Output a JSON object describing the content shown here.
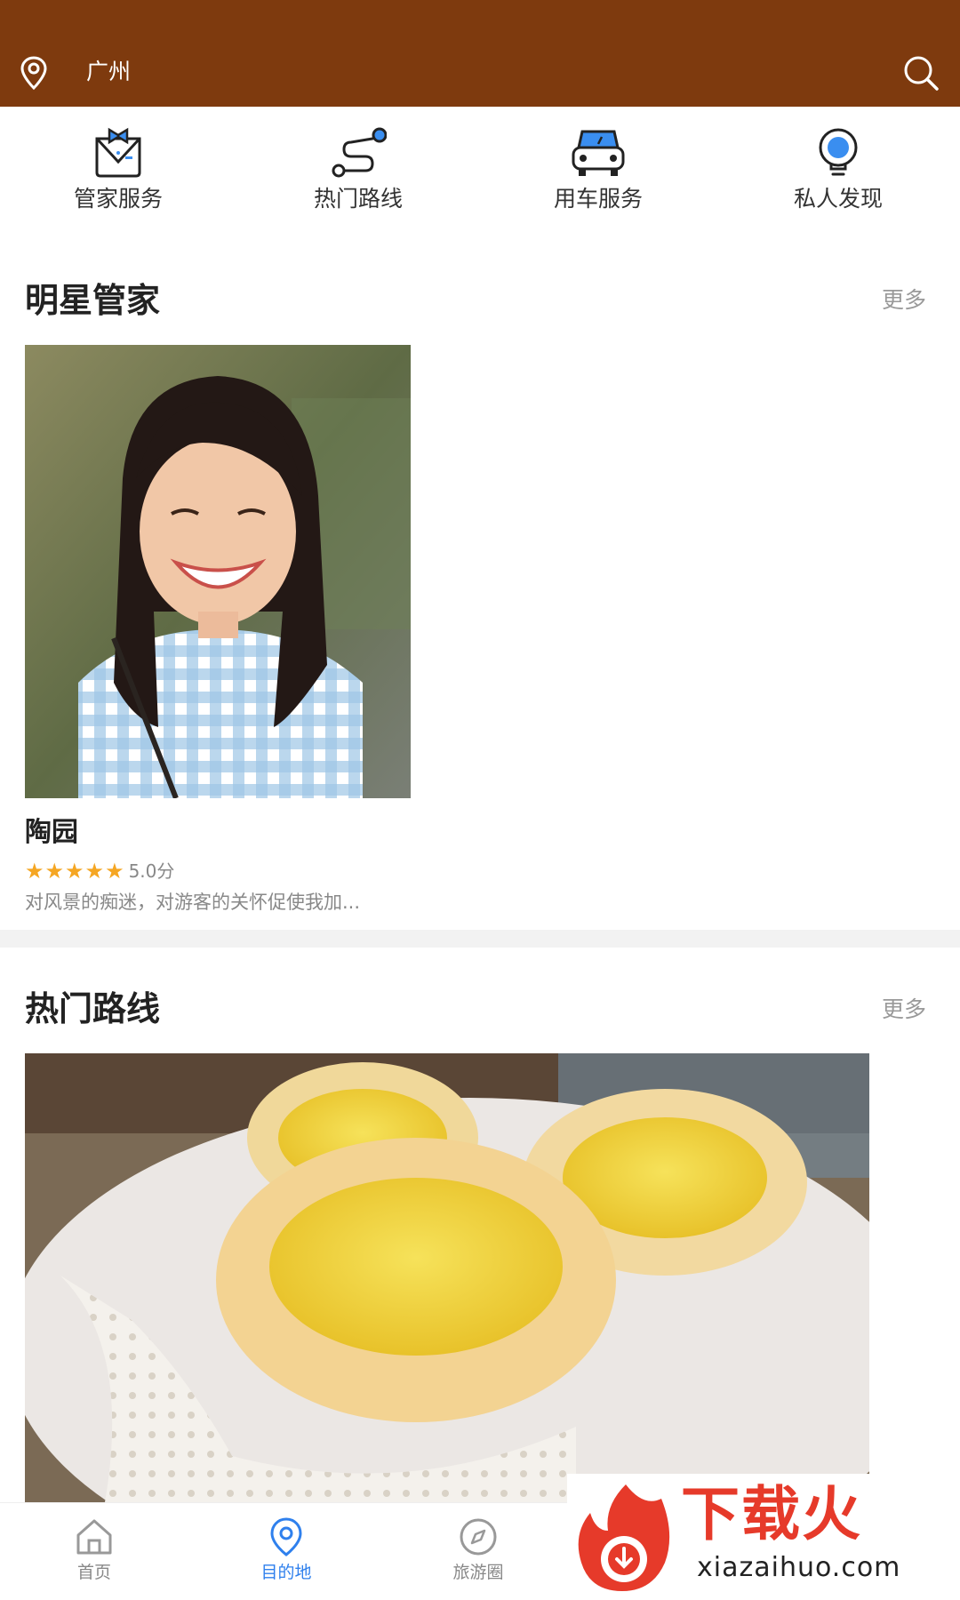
{
  "header": {
    "city": "广州",
    "bg_color": "#7e3a0e",
    "location_icon": "location-pin-icon",
    "search_icon": "search-icon"
  },
  "quick_menu": [
    {
      "label": "管家服务",
      "icon": "butler-icon"
    },
    {
      "label": "热门路线",
      "icon": "route-icon"
    },
    {
      "label": "用车服务",
      "icon": "car-icon"
    },
    {
      "label": "私人发现",
      "icon": "lightbulb-icon"
    }
  ],
  "star_butler": {
    "title": "明星管家",
    "more": "更多",
    "card": {
      "name": "陶园",
      "stars": "★★★★★",
      "rating": 5.0,
      "score_text": "5.0分",
      "desc": "对风景的痴迷，对游客的关怀促使我加..."
    }
  },
  "hot_routes": {
    "title": "热门路线",
    "more": "更多"
  },
  "tabbar": [
    {
      "label": "首页",
      "icon": "home-icon",
      "active": false
    },
    {
      "label": "目的地",
      "icon": "destination-pin-icon",
      "active": true
    },
    {
      "label": "旅游圈",
      "icon": "compass-icon",
      "active": false
    }
  ],
  "watermark": {
    "brand": "下载火",
    "url": "xiazaihuo.com"
  },
  "colors": {
    "accent_blue": "#2f80ed",
    "star_gold": "#f5a623",
    "header_brown": "#7e3a0e"
  }
}
